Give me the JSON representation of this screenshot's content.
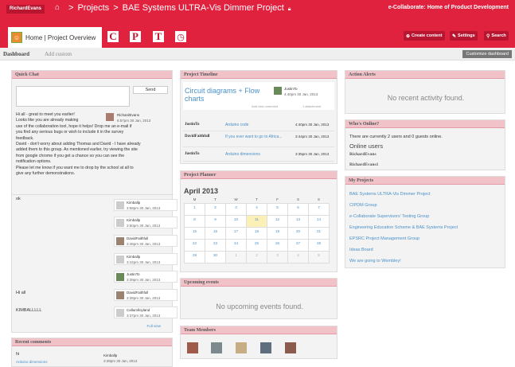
{
  "topbar": {
    "user": "RichardEvans",
    "crumb_projects": "Projects",
    "crumb_sep": ">",
    "project": "BAE Systems ULTRA-Vis Dimmer Project",
    "brand": "e-Collaborate: Home of Product Development"
  },
  "subbar": {
    "tab_label": "Home | Project Overview",
    "apps": [
      "C",
      "P",
      "T"
    ],
    "create": "Create content",
    "settings": "Settings",
    "search": "Search"
  },
  "tabs": {
    "dashboard": "Dashboard",
    "add_custom": "Add custom",
    "customize": "Customize dashboard"
  },
  "quick_chat": {
    "title": "Quick Chat",
    "send": "Send",
    "msg1": [
      "Hi all - great to meet you earlier!",
      "Looks like you are already making",
      "use of the collaboration tool, hope it helps! Drop me an e-mail if",
      "you find any serious bugs or wish to include it in the survey",
      "feedback.",
      "David - don't worry about adding Thomas and David - I have already",
      "added them to this group. As mentioned earlier, try viewing the site",
      "from google chrome if you get a chance so you can see the",
      "notification options.",
      "Please let me know if you want me to drop by the school at all to",
      "give any further demonstrations."
    ],
    "msg1_author": "RichardEvans",
    "msg1_date": "6:57pm 30 Jan, 2013",
    "ok": "ok",
    "hiall": "Hi all",
    "kimball": "KIMBALLLLL",
    "entries": [
      {
        "name": "Kimballp",
        "date": "3:58pm 30 Jan, 2013"
      },
      {
        "name": "Kimballp",
        "date": "3:50pm 30 Jan, 2013"
      },
      {
        "name": "DavidFaithfull",
        "date": "3:48pm 30 Jan, 2013"
      },
      {
        "name": "Kimballp",
        "date": "3:42pm 30 Jan, 2013"
      },
      {
        "name": "JustinTo",
        "date": "3:39pm 30 Jan, 2013"
      },
      {
        "name": "DavidFaithfull",
        "date": "3:38pm 30 Jan, 2013"
      },
      {
        "name": "Callumlloyland",
        "date": "3:37pm 30 Jan, 2013"
      }
    ],
    "full_view": "Full view"
  },
  "recent_comments": {
    "title": "Recent comments",
    "text": "hi",
    "link": "Arduino dimensions",
    "name": "Kimballp",
    "date": "3:39pm 30 Jan, 2013"
  },
  "timeline": {
    "title": "Project Timeline",
    "headline": "Circuit diagrams + Flow charts",
    "head_user": "JustinTo",
    "head_date": "4:40pm 30 Jan, 2013",
    "meta1": "Add new comment",
    "meta2": "1 attachment",
    "rows": [
      {
        "user": "JustinTo",
        "text": "Arduino code",
        "date": "4:40pm 30 Jan, 2013"
      },
      {
        "user": "DavidFaithfull",
        "text": "If you ever want to go to Africa...",
        "date": "3:44pm 30 Jan, 2013"
      },
      {
        "user": "JustinTo",
        "text": "Arduino dimensions",
        "date": "3:35pm 30 Jan, 2013"
      }
    ]
  },
  "planner": {
    "title": "Project Planner",
    "month": "April 2013",
    "days": [
      "M",
      "T",
      "W",
      "T",
      "F",
      "S",
      "S"
    ],
    "weeks": [
      [
        "1",
        "2",
        "3",
        "4",
        "5",
        "6",
        "7"
      ],
      [
        "8",
        "9",
        "10",
        "11",
        "12",
        "13",
        "14"
      ],
      [
        "15",
        "16",
        "17",
        "18",
        "19",
        "20",
        "21"
      ],
      [
        "22",
        "23",
        "24",
        "25",
        "26",
        "27",
        "28"
      ],
      [
        "29",
        "30",
        "1",
        "2",
        "3",
        "4",
        "5"
      ]
    ]
  },
  "upcoming": {
    "title": "Upcoming events",
    "empty": "No upcoming events found."
  },
  "team": {
    "title": "Team Members"
  },
  "alerts": {
    "title": "Action Alerts",
    "empty": "No recent activity found."
  },
  "online": {
    "title": "Who's Online?",
    "text": "There are currently 2 users and 0 guests online.",
    "heading": "Online users",
    "users": [
      "RichardEvans",
      "RichardEvans1"
    ]
  },
  "projects": {
    "title": "My Projects",
    "items": [
      "BAE Systems ULTRA-Vis Dimmer Project",
      "CIPDM Group",
      "e-Collaborate Supervisors' Testing Group",
      "Engineering Education Scheme & BAE Systems Project",
      "EPSRC Project Management Group",
      "Ideas Board",
      "We are going to Wembley!"
    ]
  }
}
